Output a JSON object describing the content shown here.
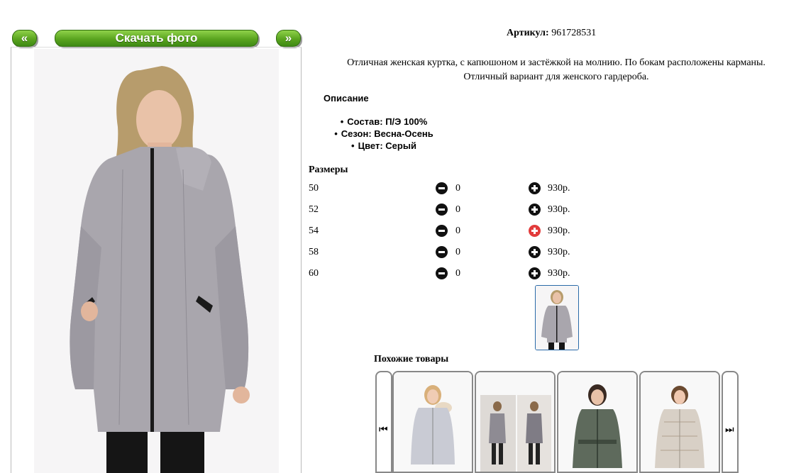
{
  "nav": {
    "prev_label": "«",
    "download_label": "Скачать фото",
    "next_label": "»"
  },
  "article": {
    "label": "Артикул:",
    "value": "961728531"
  },
  "description": {
    "line1": "Отличная женская куртка, с капюшоном и застёжкой на молнию. По бокам расположены карманы.",
    "line2": "Отличный вариант для женского гардероба."
  },
  "details": {
    "heading": "Описание",
    "items": [
      "Состав: П/Э 100%",
      "Сезон: Весна-Осень",
      "Цвет: Серый"
    ]
  },
  "sizes": {
    "heading": "Размеры",
    "rows": [
      {
        "size": "50",
        "qty": "0",
        "price": "930р."
      },
      {
        "size": "52",
        "qty": "0",
        "price": "930р."
      },
      {
        "size": "54",
        "qty": "0",
        "price": "930р."
      },
      {
        "size": "58",
        "qty": "0",
        "price": "930р."
      },
      {
        "size": "60",
        "qty": "0",
        "price": "930р."
      }
    ]
  },
  "similar": {
    "heading": "Похожие товары"
  },
  "colors": {
    "button_green": "#5aa41f",
    "plus_active": "#e23b3b",
    "jacket": "#a9a6ad",
    "thumb_border": "#2a6aa8"
  },
  "icons": {
    "minus": "minus-circle-icon",
    "plus": "plus-circle-icon",
    "carousel_prev": "skip-back-icon",
    "carousel_next": "skip-forward-icon"
  }
}
